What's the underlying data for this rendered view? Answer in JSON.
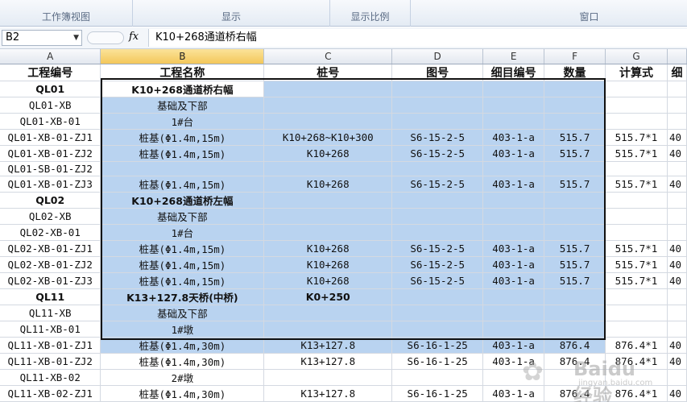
{
  "ribbon": {
    "groups": [
      "工作簿视图",
      "显示",
      "显示比例",
      "窗口"
    ]
  },
  "formula_bar": {
    "name_box": "B2",
    "fx": "fx",
    "formula": "K10+268通道桥右幅"
  },
  "columns": [
    "A",
    "B",
    "C",
    "D",
    "E",
    "F",
    "G",
    ""
  ],
  "header_row": [
    "工程编号",
    "工程名称",
    "桩号",
    "图号",
    "细目编号",
    "数量",
    "计算式",
    "细"
  ],
  "rows": [
    [
      "QL01",
      "K10+268通道桥右幅",
      "",
      "",
      "",
      "",
      "",
      ""
    ],
    [
      "QL01-XB",
      "基础及下部",
      "",
      "",
      "",
      "",
      "",
      ""
    ],
    [
      "QL01-XB-01",
      "1#台",
      "",
      "",
      "",
      "",
      "",
      ""
    ],
    [
      "QL01-XB-01-ZJ1",
      "桩基(Φ1.4m,15m)",
      "K10+268~K10+300",
      "S6-15-2-5",
      "403-1-a",
      "515.7",
      "515.7*1",
      "40"
    ],
    [
      "QL01-XB-01-ZJ2",
      "桩基(Φ1.4m,15m)",
      "K10+268",
      "S6-15-2-5",
      "403-1-a",
      "515.7",
      "515.7*1",
      "40"
    ],
    [
      "QL01-SB-01-ZJ2",
      "",
      "",
      "",
      "",
      "",
      "",
      ""
    ],
    [
      "QL01-XB-01-ZJ3",
      "桩基(Φ1.4m,15m)",
      "K10+268",
      "S6-15-2-5",
      "403-1-a",
      "515.7",
      "515.7*1",
      "40"
    ],
    [
      "QL02",
      "K10+268通道桥左幅",
      "",
      "",
      "",
      "",
      "",
      ""
    ],
    [
      "QL02-XB",
      "基础及下部",
      "",
      "",
      "",
      "",
      "",
      ""
    ],
    [
      "QL02-XB-01",
      "1#台",
      "",
      "",
      "",
      "",
      "",
      ""
    ],
    [
      "QL02-XB-01-ZJ1",
      "桩基(Φ1.4m,15m)",
      "K10+268",
      "S6-15-2-5",
      "403-1-a",
      "515.7",
      "515.7*1",
      "40"
    ],
    [
      "QL02-XB-01-ZJ2",
      "桩基(Φ1.4m,15m)",
      "K10+268",
      "S6-15-2-5",
      "403-1-a",
      "515.7",
      "515.7*1",
      "40"
    ],
    [
      "QL02-XB-01-ZJ3",
      "桩基(Φ1.4m,15m)",
      "K10+268",
      "S6-15-2-5",
      "403-1-a",
      "515.7",
      "515.7*1",
      "40"
    ],
    [
      "QL11",
      "K13+127.8天桥(中桥)",
      "K0+250",
      "",
      "",
      "",
      "",
      ""
    ],
    [
      "QL11-XB",
      "基础及下部",
      "",
      "",
      "",
      "",
      "",
      ""
    ],
    [
      "QL11-XB-01",
      "1#墩",
      "",
      "",
      "",
      "",
      "",
      ""
    ],
    [
      "QL11-XB-01-ZJ1",
      "桩基(Φ1.4m,30m)",
      "K13+127.8",
      "S6-16-1-25",
      "403-1-a",
      "876.4",
      "876.4*1",
      "40"
    ],
    [
      "QL11-XB-01-ZJ2",
      "桩基(Φ1.4m,30m)",
      "K13+127.8",
      "S6-16-1-25",
      "403-1-a",
      "876.4",
      "876.4*1",
      "40"
    ],
    [
      "QL11-XB-02",
      "2#墩",
      "",
      "",
      "",
      "",
      "",
      ""
    ],
    [
      "QL11-XB-02-ZJ1",
      "桩基(Φ1.4m,30m)",
      "K13+127.8",
      "S6-16-1-25",
      "403-1-a",
      "876.4",
      "876.4*1",
      "40"
    ],
    [
      "QL11-XB-02-ZJ2",
      "桩基(Φ1.4m,30m)",
      "K13+127.8",
      "S6-16-1-25",
      "403-1-a",
      "876.4",
      "876.4*1",
      "40"
    ]
  ],
  "selection_color": "#b9d3f0",
  "watermark": {
    "text": "Baidu经验",
    "sub": "jingyan.baidu.com"
  }
}
